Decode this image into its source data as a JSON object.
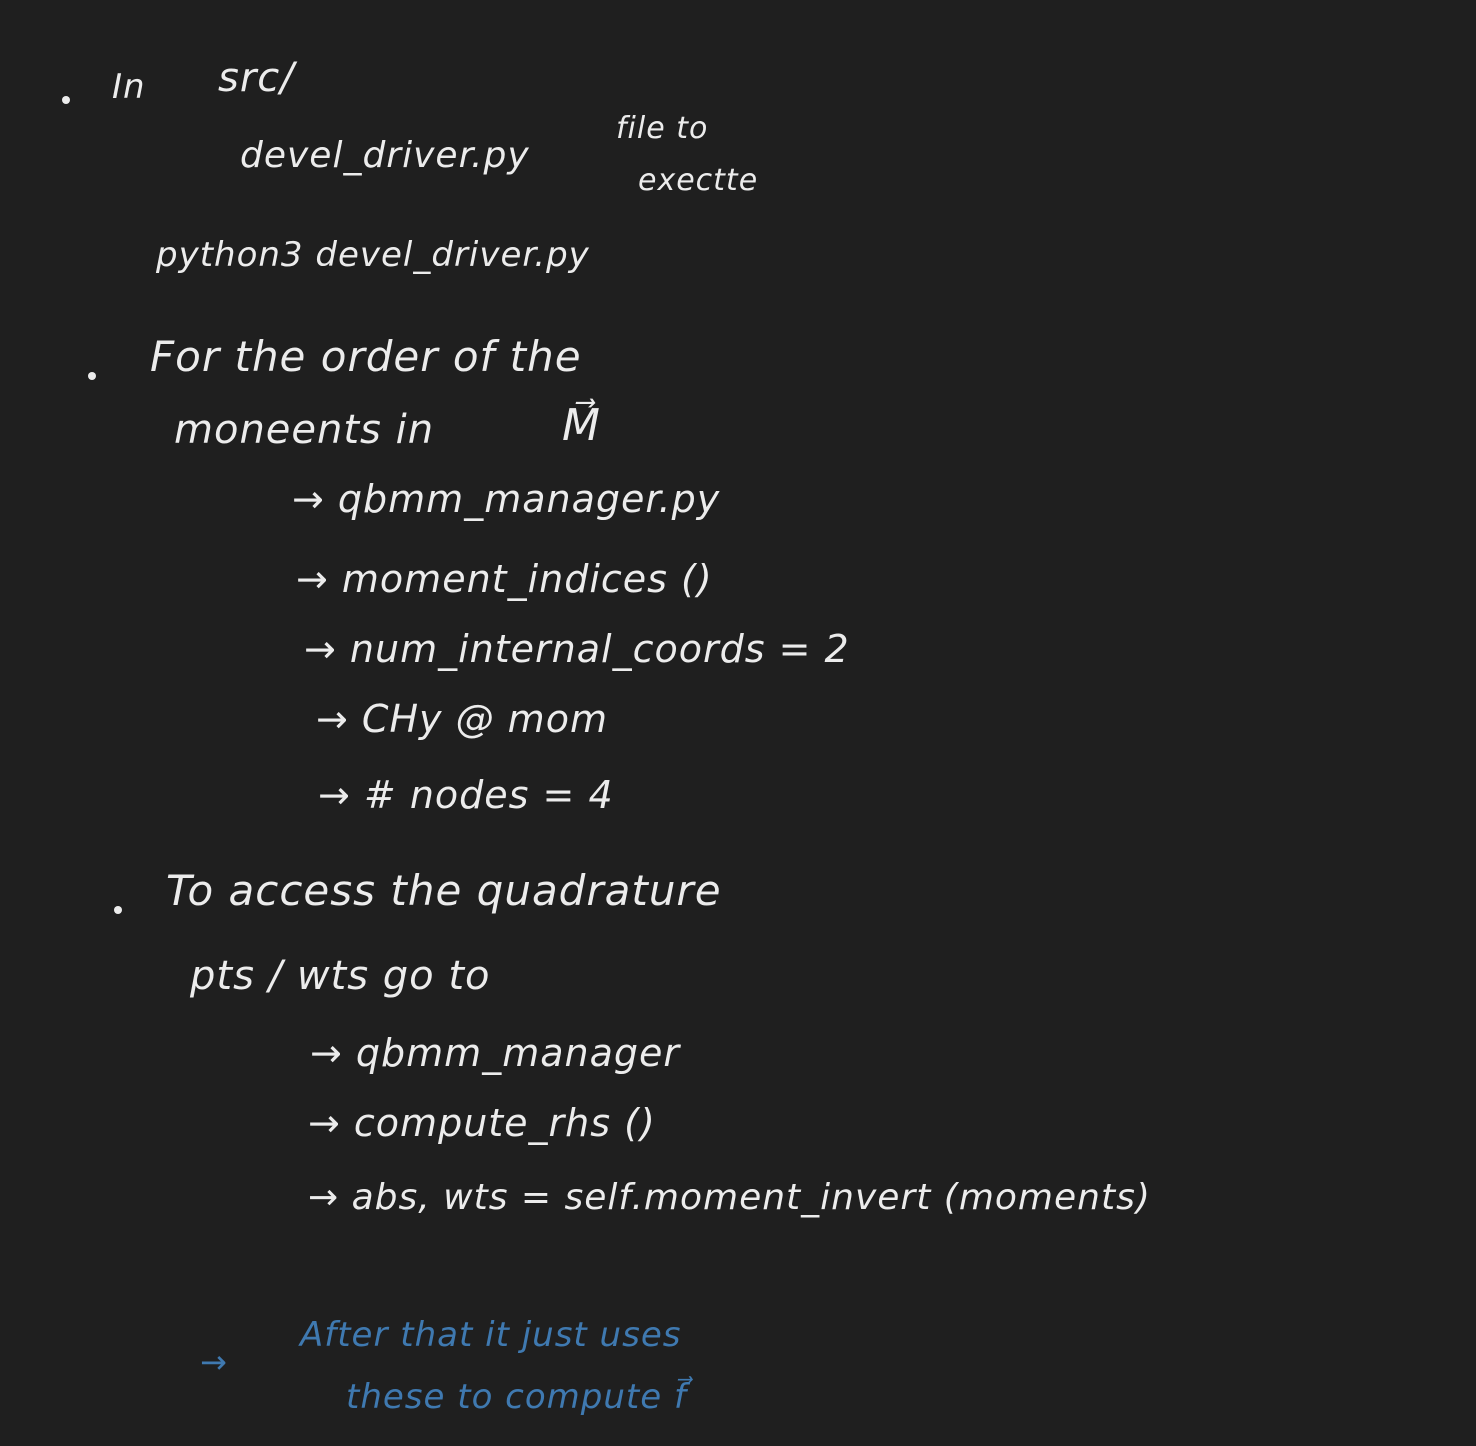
{
  "notes": {
    "section1": {
      "heading_prefix": "In",
      "heading_path": "src/",
      "driver_file": "devel_driver.py",
      "driver_note_line1": "file to",
      "driver_note_line2": "exectte",
      "command": "python3  devel_driver.py"
    },
    "section2": {
      "line1": "For the order of the",
      "line2_prefix": "moneents  in",
      "line2_symbol": "M⃗",
      "steps": [
        "→ qbmm_manager.py",
        "→ moment_indices ()",
        "→ num_internal_coords = 2",
        "→ CHy @ mom",
        "→ # nodes  = 4"
      ]
    },
    "section3": {
      "line1": "To access the quadrature",
      "line2": "pts / wts   go to",
      "steps": [
        "→ qbmm_manager",
        "→ compute_rhs ()",
        "→ abs, wts = self.moment_invert (moments)"
      ]
    },
    "followup": {
      "arrow": "→",
      "line1": "After that  it just  uses",
      "line2": "these to  compute  f⃗"
    }
  },
  "colors": {
    "background": "#1f1f1f",
    "ink": "#ececec",
    "blue_ink": "#3f79b0"
  }
}
